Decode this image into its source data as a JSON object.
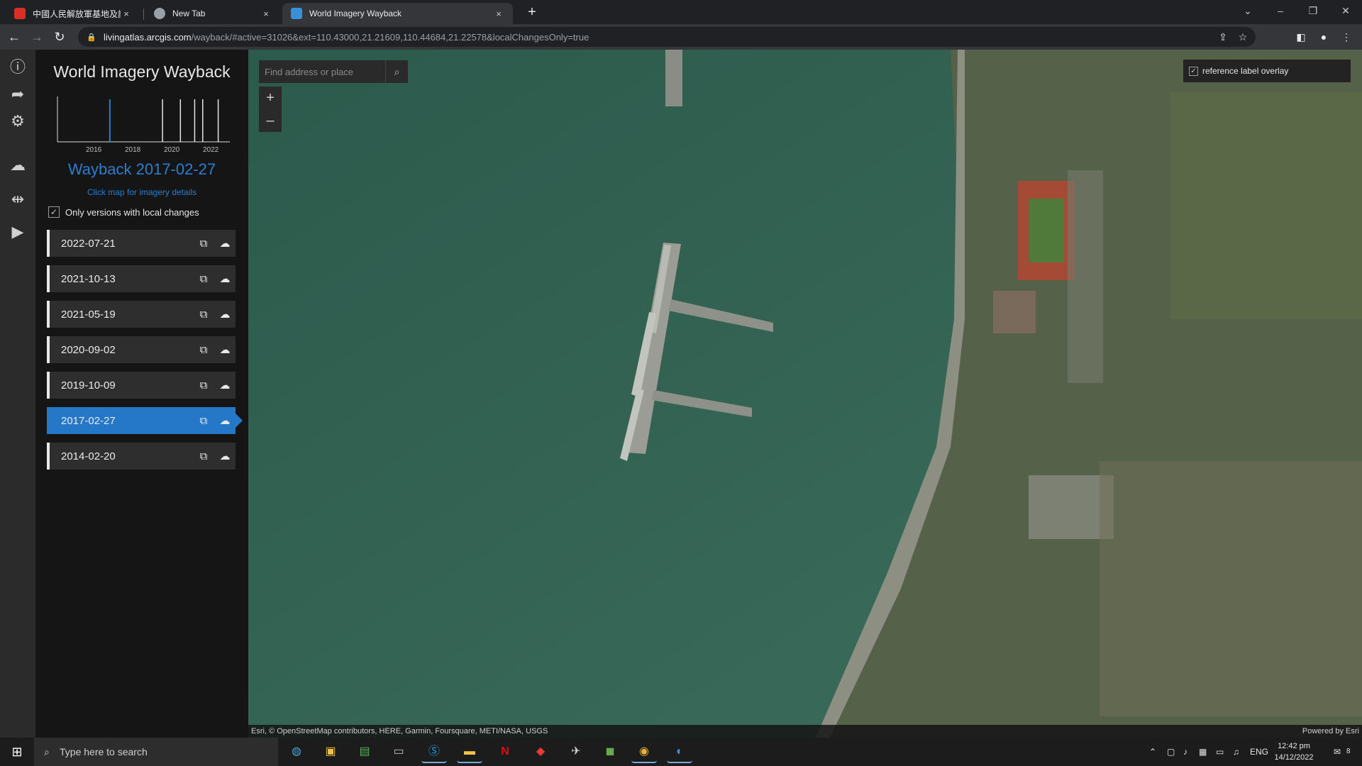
{
  "browser": {
    "tabs": [
      {
        "title": "中國人民解放軍基地及設施 (持續",
        "close": "×",
        "icon": "pin-favicon",
        "color": "#d93025"
      },
      {
        "title": "New Tab",
        "close": "×",
        "icon": "chrome-favicon",
        "color": "#9aa0a6"
      },
      {
        "title": "World Imagery Wayback",
        "close": "×",
        "icon": "arcgis-favicon",
        "color": "#3a8fd6"
      }
    ],
    "new_tab": "+",
    "url_host": "livingatlas.arcgis.com",
    "url_path": "/wayback/#active=31026&ext=110.43000,21.21609,110.44684,21.22578&localChangesOnly=true",
    "window_controls": [
      "⌄",
      "–",
      "❐",
      "✕"
    ]
  },
  "app": {
    "title": "World Imagery Wayback",
    "timeline": {
      "year_labels": [
        "2016",
        "2018",
        "2020",
        "2022"
      ],
      "selected_year": 2017.16,
      "release_years": [
        2017.16,
        2019.78,
        2020.67,
        2021.38,
        2021.78,
        2022.55
      ]
    },
    "selected_title": "Wayback 2017-02-27",
    "click_hint": "Click map for imagery details",
    "local_changes_label": "Only versions with local changes",
    "local_changes_checked": true,
    "releases": [
      {
        "date": "2022-07-21",
        "selected": false
      },
      {
        "date": "2021-10-13",
        "selected": false
      },
      {
        "date": "2021-05-19",
        "selected": false
      },
      {
        "date": "2020-09-02",
        "selected": false
      },
      {
        "date": "2019-10-09",
        "selected": false
      },
      {
        "date": "2017-02-27",
        "selected": true
      },
      {
        "date": "2014-02-20",
        "selected": false
      }
    ]
  },
  "map": {
    "search_placeholder": "Find address or place",
    "zoom_in": "+",
    "zoom_out": "–",
    "reference_label": "reference label overlay",
    "reference_checked": true,
    "attribution": "Esri, © OpenStreetMap contributors, HERE, Garmin, Foursquare, METI/NASA, USGS",
    "powered_by": "Powered by Esri"
  },
  "taskbar": {
    "search_placeholder": "Type here to search",
    "apps": [
      "edge-icon",
      "store-icon",
      "terminal-icon",
      "window-icon",
      "skype-icon",
      "file-explorer-icon",
      "netflix-icon",
      "app-red-icon",
      "app-fighter-icon",
      "minecraft-icon",
      "chrome-icon",
      "earth-icon"
    ],
    "lang": "ENG",
    "time": "12:42 pm",
    "date": "14/12/2022",
    "notifications": "8"
  }
}
